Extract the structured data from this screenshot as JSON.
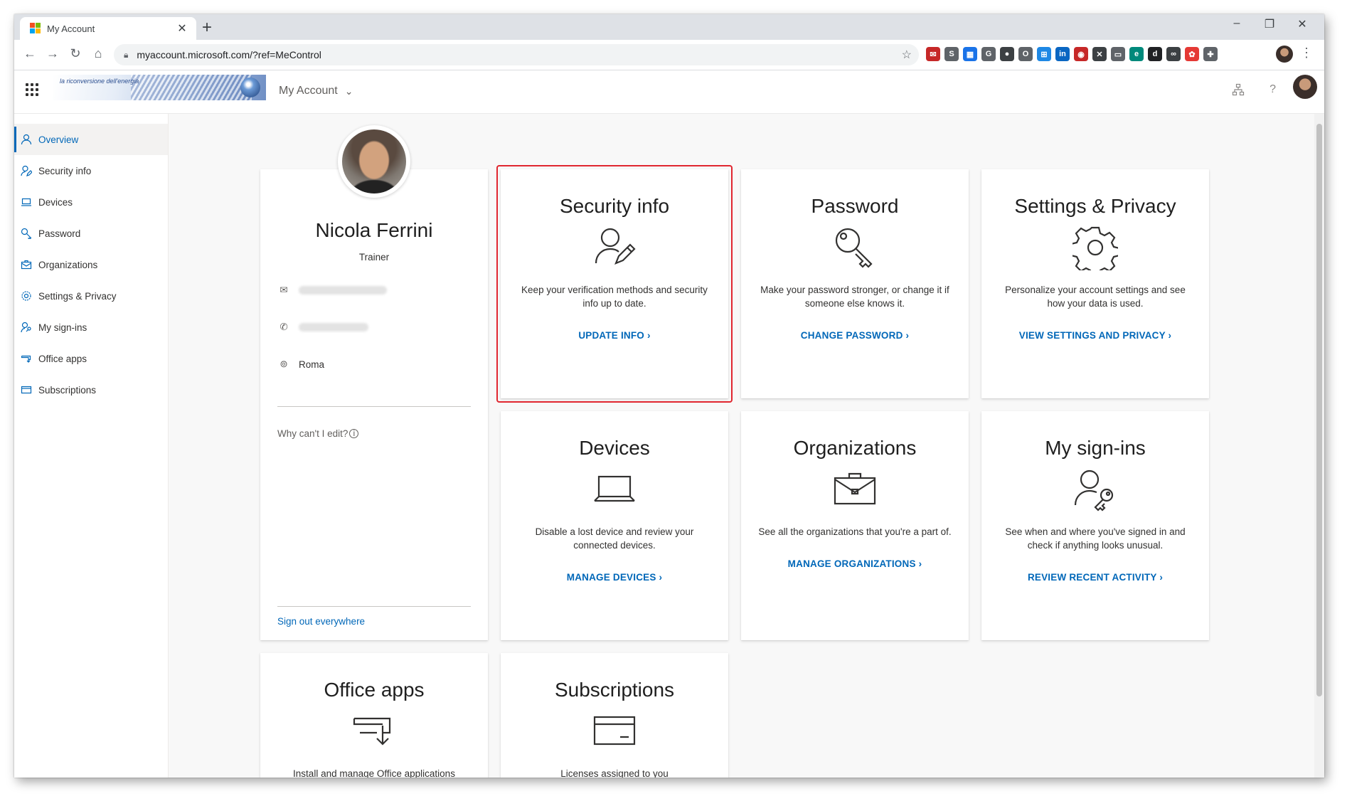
{
  "browser": {
    "tab_title": "My Account",
    "url": "myaccount.microsoft.com/?ref=MeControl",
    "window_controls": [
      "–",
      "❐",
      "✕"
    ],
    "extensions": [
      {
        "icon": "mail-icon",
        "color": "#c62828",
        "glyph": "✉"
      },
      {
        "icon": "skype-icon",
        "color": "#5f6368",
        "glyph": "S"
      },
      {
        "icon": "grid-icon",
        "color": "#1a73e8",
        "glyph": "▦"
      },
      {
        "icon": "google-icon",
        "color": "#5f6368",
        "glyph": "G"
      },
      {
        "icon": "circle-icon",
        "color": "#3c4043",
        "glyph": "●"
      },
      {
        "icon": "office-icon",
        "color": "#5f6368",
        "glyph": "O"
      },
      {
        "icon": "windows-icon",
        "color": "#1e88e5",
        "glyph": "⊞"
      },
      {
        "icon": "linkedin-icon",
        "color": "#0a66c2",
        "glyph": "in"
      },
      {
        "icon": "record-icon",
        "color": "#c62828",
        "glyph": "◉"
      },
      {
        "icon": "mute-icon",
        "color": "#3c4043",
        "glyph": "✕"
      },
      {
        "icon": "cast-icon",
        "color": "#5f6368",
        "glyph": "▭"
      },
      {
        "icon": "edge-icon",
        "color": "#00897b",
        "glyph": "e"
      },
      {
        "icon": "d-icon",
        "color": "#202124",
        "glyph": "d"
      },
      {
        "icon": "link-icon",
        "color": "#3c4043",
        "glyph": "∞"
      },
      {
        "icon": "color-icon",
        "color": "#e53935",
        "glyph": "✿"
      },
      {
        "icon": "puzzle-icon",
        "color": "#5f6368",
        "glyph": "✚"
      }
    ]
  },
  "header": {
    "logo_text": "la riconversione dell'energia",
    "app_name": "My Account"
  },
  "sidebar": {
    "items": [
      {
        "label": "Overview",
        "icon": "person-icon",
        "active": true
      },
      {
        "label": "Security info",
        "icon": "person-edit-icon"
      },
      {
        "label": "Devices",
        "icon": "laptop-icon"
      },
      {
        "label": "Password",
        "icon": "key-icon"
      },
      {
        "label": "Organizations",
        "icon": "briefcase-icon"
      },
      {
        "label": "Settings & Privacy",
        "icon": "gear-icon"
      },
      {
        "label": "My sign-ins",
        "icon": "person-key-icon"
      },
      {
        "label": "Office apps",
        "icon": "office-apps-icon"
      },
      {
        "label": "Subscriptions",
        "icon": "card-icon"
      }
    ]
  },
  "profile": {
    "name": "Nicola Ferrini",
    "role": "Trainer",
    "location": "Roma",
    "why_cant_edit": "Why can't I edit?",
    "sign_out": "Sign out everywhere"
  },
  "cards": {
    "security": {
      "title": "Security info",
      "desc": "Keep your verification methods and security info up to date.",
      "link": "UPDATE INFO"
    },
    "password": {
      "title": "Password",
      "desc": "Make your password stronger, or change it if someone else knows it.",
      "link": "CHANGE PASSWORD"
    },
    "settings": {
      "title": "Settings & Privacy",
      "desc": "Personalize your account settings and see how your data is used.",
      "link": "VIEW SETTINGS AND PRIVACY"
    },
    "devices": {
      "title": "Devices",
      "desc": "Disable a lost device and review your connected devices.",
      "link": "MANAGE DEVICES"
    },
    "organizations": {
      "title": "Organizations",
      "desc": "See all the organizations that you're a part of.",
      "link": "MANAGE ORGANIZATIONS"
    },
    "signins": {
      "title": "My sign-ins",
      "desc": "See when and where you've signed in and check if anything looks unusual.",
      "link": "REVIEW RECENT ACTIVITY"
    },
    "office": {
      "title": "Office apps",
      "desc": "Install and manage Office applications"
    },
    "subscriptions": {
      "title": "Subscriptions",
      "desc": "Licenses assigned to you"
    }
  },
  "colors": {
    "accent": "#0067b8",
    "highlight": "#e0262f"
  }
}
